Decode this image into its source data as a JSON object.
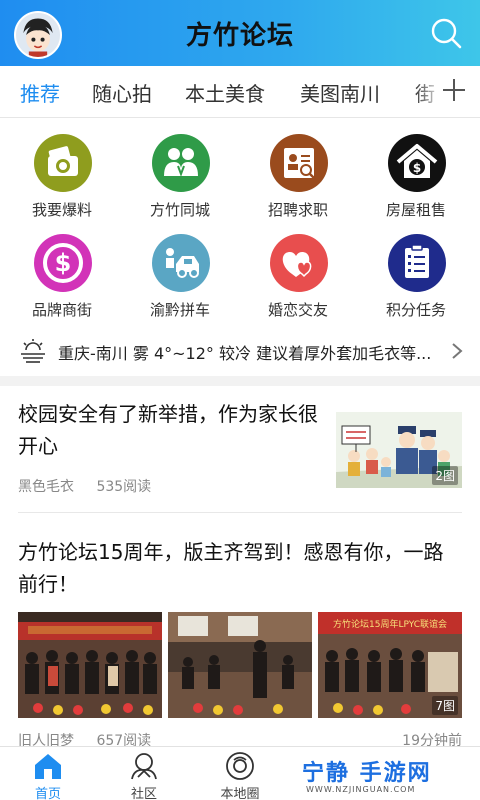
{
  "header": {
    "title": "方竹论坛",
    "avatar_icon": "avatar-icon",
    "search_icon": "search-icon"
  },
  "tabs": [
    {
      "label": "推荐",
      "active": true
    },
    {
      "label": "随心拍",
      "active": false
    },
    {
      "label": "本土美食",
      "active": false
    },
    {
      "label": "美图南川",
      "active": false
    },
    {
      "label": "街",
      "active": false
    }
  ],
  "grid": [
    {
      "label": "我要爆料",
      "icon": "camera-icon",
      "color": "#8f9d1e"
    },
    {
      "label": "方竹同城",
      "icon": "people-icon",
      "color": "#2f9b48"
    },
    {
      "label": "招聘求职",
      "icon": "resume-icon",
      "color": "#9a4b1d"
    },
    {
      "label": "房屋租售",
      "icon": "house-icon",
      "color": "#111111"
    },
    {
      "label": "品牌商街",
      "icon": "dollar-icon",
      "color": "#d233b8"
    },
    {
      "label": "渝黔拼车",
      "icon": "car-icon",
      "color": "#5aa6c4"
    },
    {
      "label": "婚恋交友",
      "icon": "hearts-icon",
      "color": "#e84e4e"
    },
    {
      "label": "积分任务",
      "icon": "checklist-icon",
      "color": "#1f2b8c"
    }
  ],
  "weather": {
    "text": "重庆-南川 雾 4°~12° 较冷 建议着厚外套加毛衣等...",
    "icon": "fog-weather-icon"
  },
  "articles": [
    {
      "title": "校园安全有了新举措，作为家长很开心",
      "author": "黑色毛衣",
      "reads": "535阅读",
      "image_count": "2图"
    },
    {
      "title": "方竹论坛15周年，版主齐驾到！感恩有你，一路前行！",
      "author": "旧人旧梦",
      "reads": "657阅读",
      "time": "19分钟前",
      "image_count": "7图",
      "banner_text": "方竹论坛15周年LPYC联谊会"
    }
  ],
  "bottom_nav": [
    {
      "label": "首页",
      "icon": "home-icon",
      "active": true
    },
    {
      "label": "社区",
      "icon": "community-icon",
      "active": false
    },
    {
      "label": "本地圈",
      "icon": "local-circle-icon",
      "active": false
    }
  ],
  "watermark": {
    "text": "宁静 手游网",
    "sub": "WWW.NZJINGUAN.COM"
  },
  "colors": {
    "accent": "#1e8df0",
    "header_start": "#1f8df0",
    "header_end": "#3ec6e9"
  }
}
